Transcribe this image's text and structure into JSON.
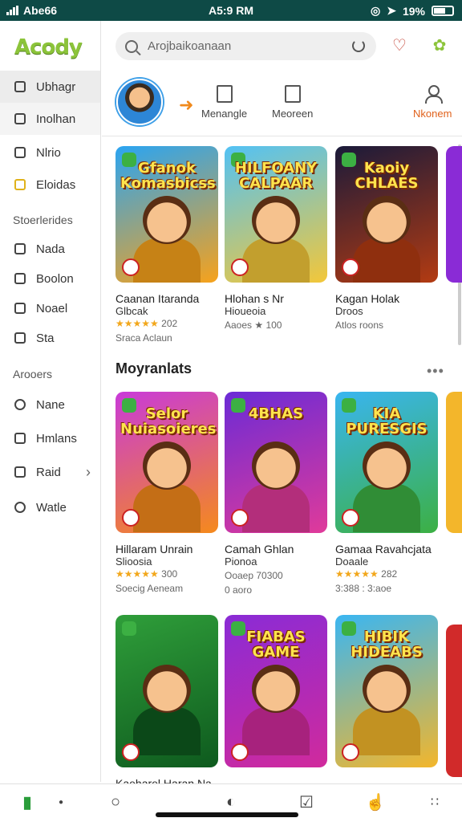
{
  "status": {
    "carrier": "Abe66",
    "time": "A5:9 RM",
    "battery": "19%"
  },
  "logo": "Acody",
  "search": {
    "placeholder": "Arojbaikoanaan"
  },
  "sidebar": {
    "items_top": [
      {
        "label": "Ubhagr",
        "icon": "home-icon"
      },
      {
        "label": "Inolhan",
        "icon": "list-icon"
      },
      {
        "label": "Nlrio",
        "icon": "box-icon"
      },
      {
        "label": "Eloidas",
        "icon": "star-icon"
      }
    ],
    "section1": "Stoerlerides",
    "items_mid": [
      {
        "label": "Nada",
        "icon": "chat-icon"
      },
      {
        "label": "Boolon",
        "icon": "play-icon"
      },
      {
        "label": "Noael",
        "icon": "grid-icon"
      },
      {
        "label": "Sta",
        "icon": "clock-icon"
      }
    ],
    "section2": "Arooers",
    "items_bottom": [
      {
        "label": "Nane",
        "icon": "info-icon"
      },
      {
        "label": "Hmlans",
        "icon": "bag-icon"
      },
      {
        "label": "Raid",
        "icon": "refresh-icon"
      },
      {
        "label": "Watle",
        "icon": "check-icon"
      }
    ]
  },
  "header": {
    "btn1": "Menangle",
    "btn2": "Meoreen",
    "btn3": "Nkonem"
  },
  "row1": [
    {
      "art": "Gfanok Komasbicss",
      "name": "Caanan Itaranda",
      "sub": "Glbcak",
      "stars": "★★★★★",
      "rating": "202",
      "meta": "Sraca Aclaun",
      "c1": "#2aa4f2",
      "c2": "#f7a21b"
    },
    {
      "art": "HILFOANY CALPAAR",
      "name": "Hlohan s Nr",
      "sub": "Hioueoia",
      "stars": "",
      "rating": "",
      "meta": "Aaoes ★ 100",
      "c1": "#52c2f5",
      "c2": "#f3c739"
    },
    {
      "art": "Kaoiy CHLAES",
      "name": "Kagan Holak",
      "sub": "Droos",
      "stars": "",
      "rating": "",
      "meta": "Atlos roons",
      "c1": "#1a1a3a",
      "c2": "#b33b12"
    }
  ],
  "section_title": "Moyranlats",
  "row2": [
    {
      "art": "Selor Nuiasoieres",
      "name": "Hillaram Unrain",
      "sub": "Slioosia",
      "stars": "★★★★★",
      "rating": "300",
      "meta": "Soecig Aeneam",
      "c1": "#c93ad9",
      "c2": "#f58a1c"
    },
    {
      "art": "4BHAS",
      "name": "Camah Ghlan",
      "sub": "Pionoa",
      "stars": "",
      "rating": "",
      "meta": "Ooaep 70300",
      "meta2": "0 aoro",
      "c1": "#6b2bd6",
      "c2": "#e03a9a"
    },
    {
      "art": "KIA PURESGIS",
      "name": "Gamaa Ravahcjata",
      "sub": "Doaale",
      "stars": "★★★★★",
      "rating": "282",
      "meta": "3:388 : 3:aoe",
      "c1": "#39b5f0",
      "c2": "#3cb043"
    }
  ],
  "row3": [
    {
      "art": "",
      "name": "Kaeharel Haran Na",
      "c1": "#2f9e3a",
      "c2": "#0e5a1e"
    },
    {
      "art": "FIABAS GAME",
      "name": "",
      "c1": "#8a2bd6",
      "c2": "#d12a9c"
    },
    {
      "art": "HIBIK HIDEABS",
      "name": "",
      "c1": "#3ab6f2",
      "c2": "#f3b62b"
    }
  ],
  "colors": {
    "statusbar": "#0e4a46",
    "accent": "#e0601a",
    "logo": "#8cc43a",
    "stars": "#f2a71b"
  }
}
